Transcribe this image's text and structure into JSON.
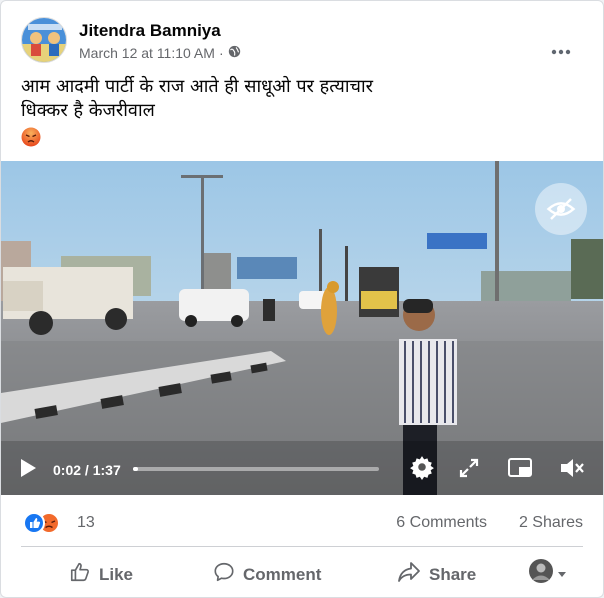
{
  "post": {
    "author": "Jitendra Bamniya",
    "timestamp": "March 12 at 11:10 AM",
    "audience_icon": "globe-icon",
    "text_line1": "आम आदमी पार्टी के राज आते ही साधूओ पर हत्याचार",
    "text_line2": "धिक्कर है केजरीवाल",
    "more_icon": "more-options-icon"
  },
  "video": {
    "current_time": "0:02",
    "separator": " / ",
    "duration": "1:37",
    "progress": 0.02
  },
  "reactions": {
    "count": "13",
    "comments": "6 Comments",
    "shares": "2 Shares"
  },
  "actions": {
    "like": "Like",
    "comment": "Comment",
    "share": "Share"
  },
  "colors": {
    "like_blue": "#1877f2",
    "angry_orange": "#f26a2b",
    "secondary_text": "#65676b"
  }
}
